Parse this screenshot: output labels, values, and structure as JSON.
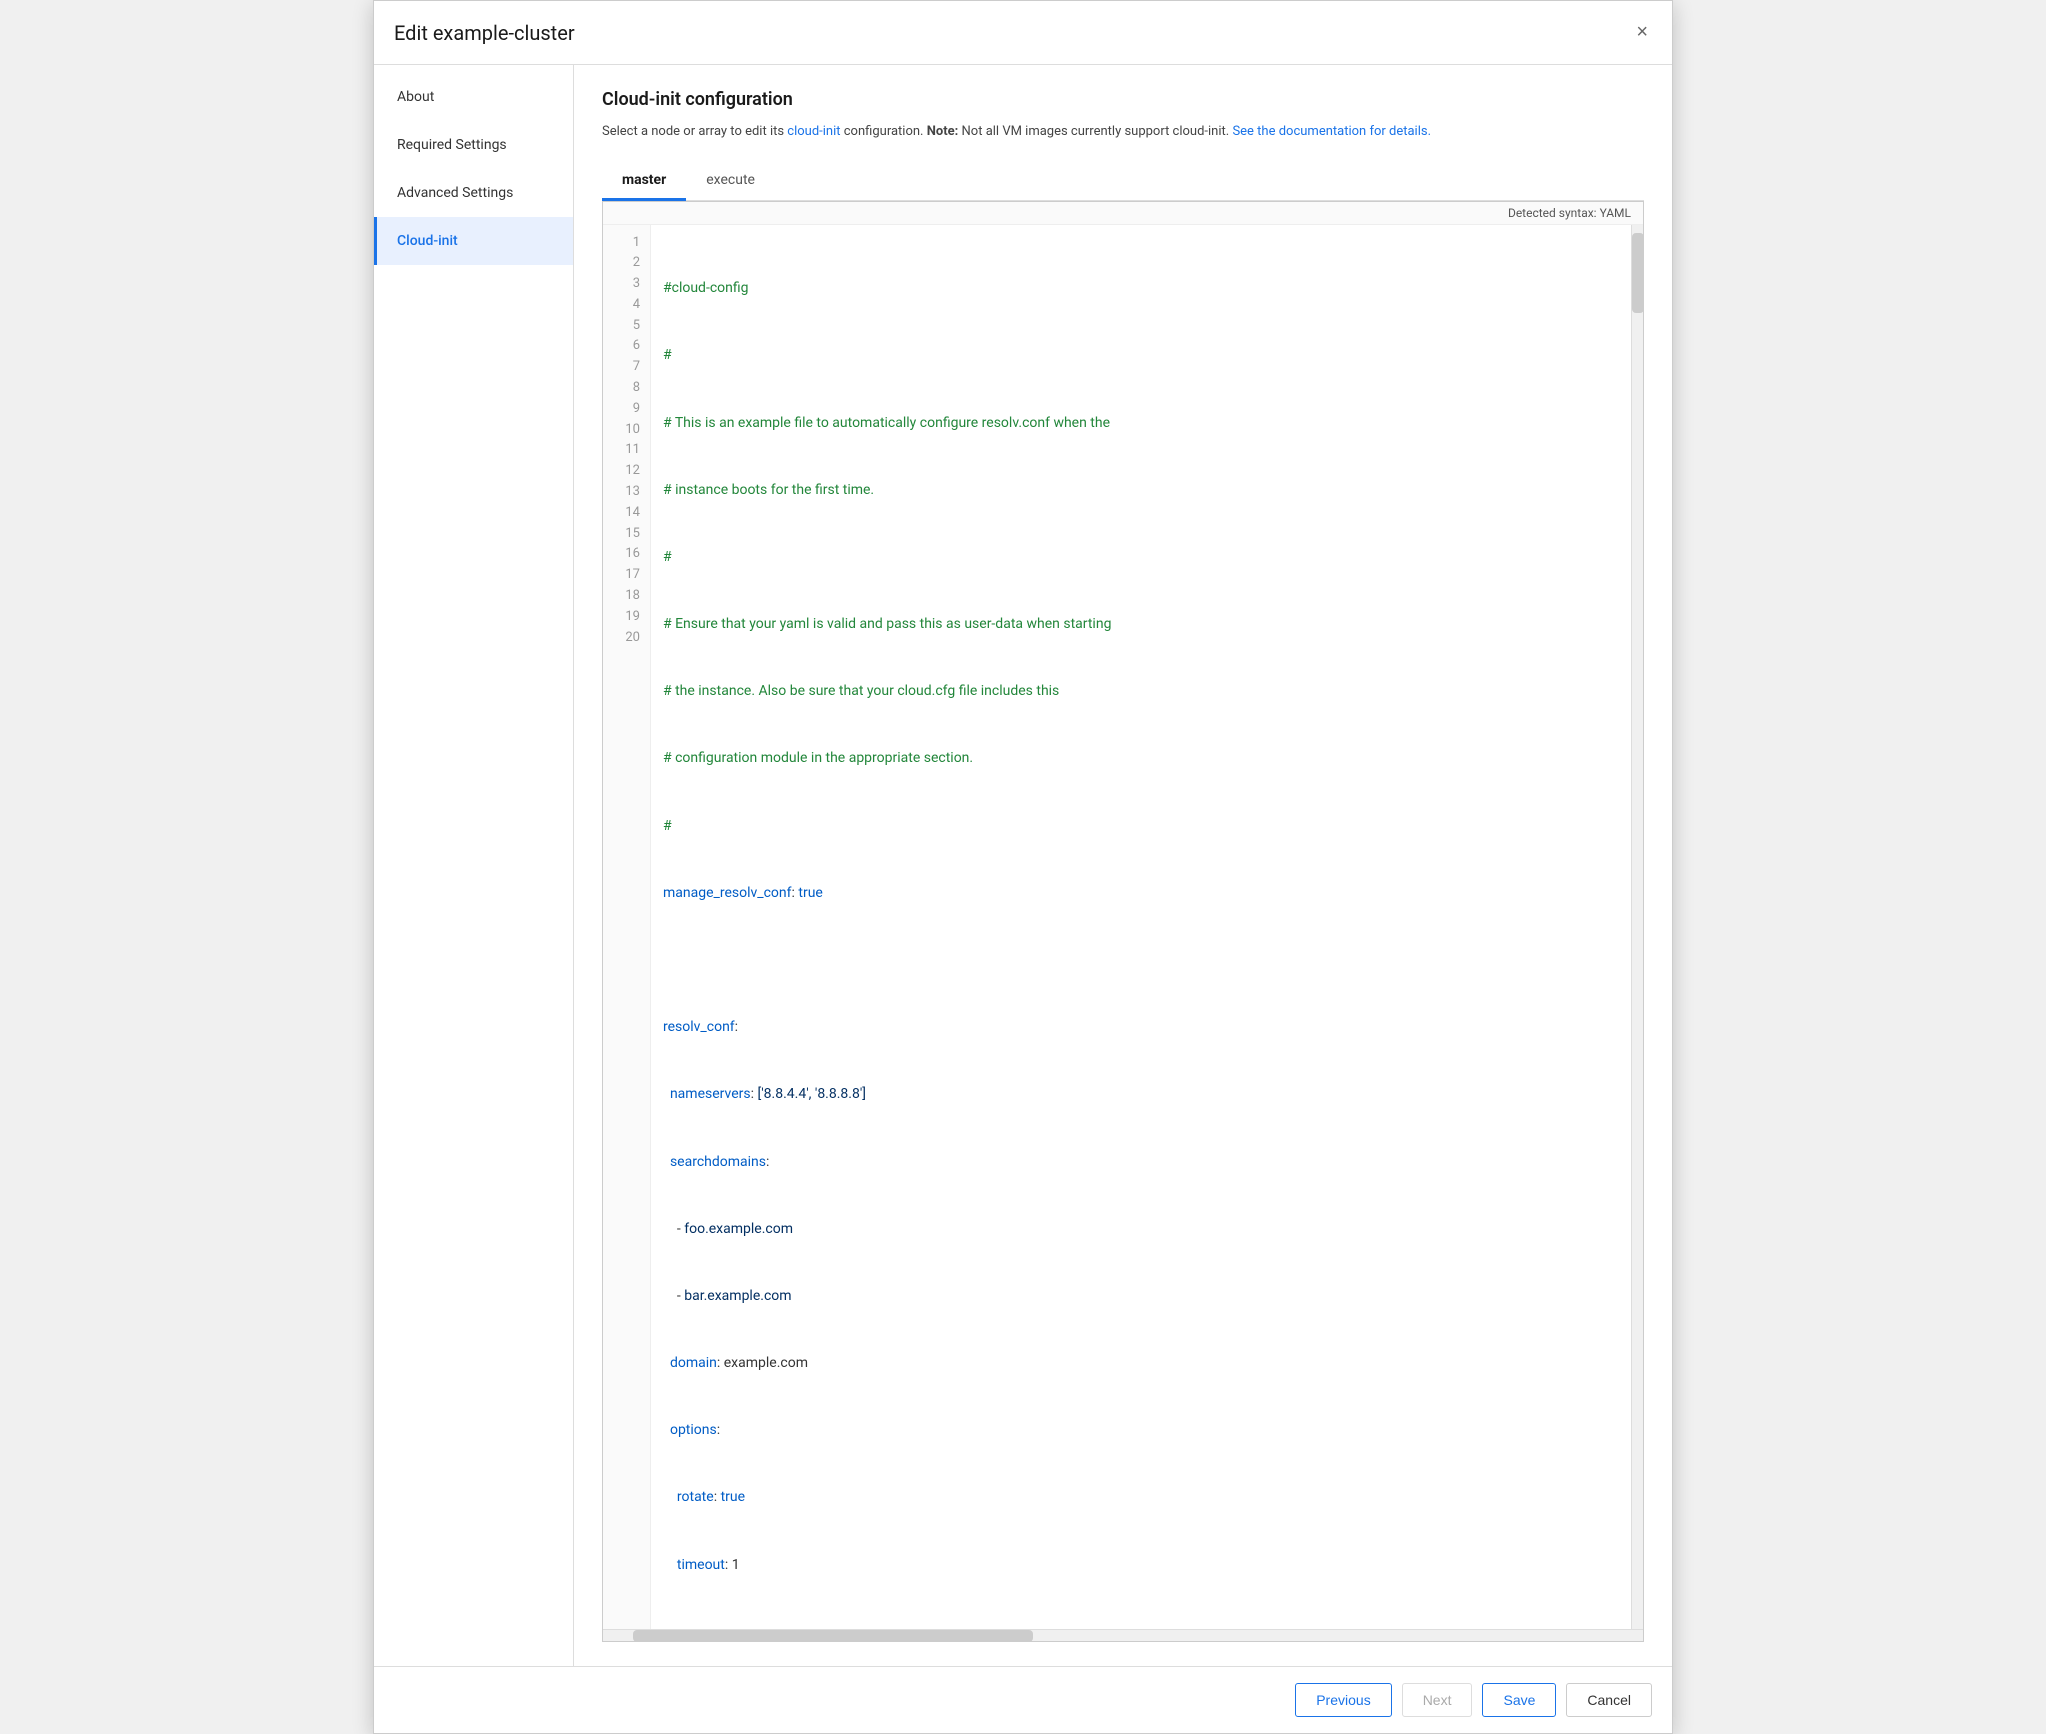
{
  "dialog": {
    "title": "Edit example-cluster",
    "close_label": "×"
  },
  "sidebar": {
    "items": [
      {
        "id": "about",
        "label": "About",
        "active": false
      },
      {
        "id": "required-settings",
        "label": "Required Settings",
        "active": false
      },
      {
        "id": "advanced-settings",
        "label": "Advanced Settings",
        "active": false
      },
      {
        "id": "cloud-init",
        "label": "Cloud-init",
        "active": true
      }
    ]
  },
  "main": {
    "section_title": "Cloud-init configuration",
    "desc_part1": "Select a node or array to edit its ",
    "desc_link": "cloud-init",
    "desc_part2": " configuration. ",
    "desc_note_bold": "Note:",
    "desc_part3": " Not all VM images currently support cloud-init. ",
    "desc_doc_link": "See the documentation for details.",
    "tabs": [
      {
        "id": "master",
        "label": "master",
        "active": true
      },
      {
        "id": "execute",
        "label": "execute",
        "active": false
      }
    ],
    "syntax_label": "Detected syntax: YAML",
    "code_lines": [
      {
        "num": 1,
        "content": "#cloud-config",
        "type": "comment"
      },
      {
        "num": 2,
        "content": "#",
        "type": "comment"
      },
      {
        "num": 3,
        "content": "# This is an example file to automatically configure resolv.conf when the",
        "type": "comment"
      },
      {
        "num": 4,
        "content": "# instance boots for the first time.",
        "type": "comment"
      },
      {
        "num": 5,
        "content": "#",
        "type": "comment"
      },
      {
        "num": 6,
        "content": "# Ensure that your yaml is valid and pass this as user-data when starting",
        "type": "comment"
      },
      {
        "num": 7,
        "content": "# the instance. Also be sure that your cloud.cfg file includes this",
        "type": "comment"
      },
      {
        "num": 8,
        "content": "# configuration module in the appropriate section.",
        "type": "comment"
      },
      {
        "num": 9,
        "content": "#",
        "type": "comment"
      },
      {
        "num": 10,
        "content": "manage_resolv_conf: true",
        "type": "key-bool",
        "key": "manage_resolv_conf",
        "val": "true"
      },
      {
        "num": 11,
        "content": "",
        "type": "blank"
      },
      {
        "num": 12,
        "content": "resolv_conf:",
        "type": "key",
        "key": "resolv_conf"
      },
      {
        "num": 13,
        "content": "  nameservers: ['8.8.4.4', '8.8.8.8']",
        "type": "key-str",
        "key": "  nameservers",
        "val": " ['8.8.4.4', '8.8.8.8']"
      },
      {
        "num": 14,
        "content": "  searchdomains:",
        "type": "key",
        "key": "  searchdomains"
      },
      {
        "num": 15,
        "content": "    - foo.example.com",
        "type": "list-str",
        "val": "foo.example.com"
      },
      {
        "num": 16,
        "content": "    - bar.example.com",
        "type": "list-str",
        "val": "bar.example.com"
      },
      {
        "num": 17,
        "content": "  domain: example.com",
        "type": "key-str2",
        "key": "  domain",
        "val": " example.com"
      },
      {
        "num": 18,
        "content": "  options:",
        "type": "key",
        "key": "  options"
      },
      {
        "num": 19,
        "content": "    rotate: true",
        "type": "key-bool2",
        "key": "    rotate",
        "val": "true"
      },
      {
        "num": 20,
        "content": "    timeout: 1",
        "type": "key-val2",
        "key": "    timeout",
        "val": "1"
      }
    ]
  },
  "footer": {
    "previous_label": "Previous",
    "next_label": "Next",
    "save_label": "Save",
    "cancel_label": "Cancel"
  }
}
